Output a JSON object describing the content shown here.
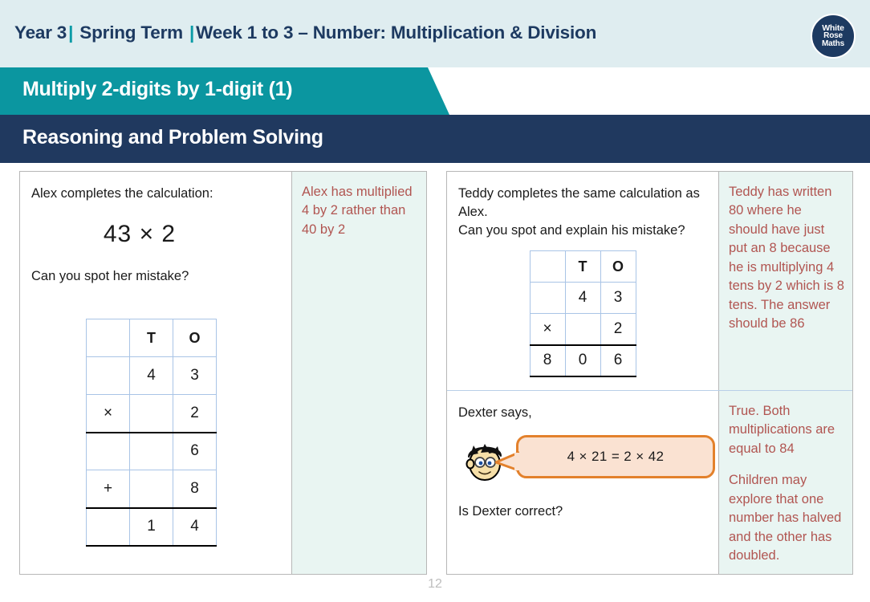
{
  "header": {
    "year": "Year 3",
    "term": "Spring Term",
    "week": "Week 1 to 3 – Number: Multiplication & Division",
    "separator": "|",
    "logo": {
      "line1": "White",
      "line2": "Rose",
      "line3": "Maths"
    },
    "colors": {
      "band": "#dfedf0",
      "text": "#1d3a61",
      "accent": "#0b9ba6"
    }
  },
  "title_bar": {
    "lesson_title": "Multiply 2-digits by 1-digit (1)",
    "section_title": "Reasoning and Problem Solving",
    "colors": {
      "teal": "#0b96a0",
      "navy": "#20395f"
    }
  },
  "questions": [
    {
      "id": "alex",
      "prompt": "Alex completes the calculation:",
      "equation": "43 × 2",
      "follow_up": "Can you spot her mistake?",
      "table": {
        "rows": [
          {
            "cells": [
              "",
              "T",
              "O"
            ],
            "header": true,
            "rule_below": false
          },
          {
            "cells": [
              "",
              "4",
              "3"
            ],
            "header": false,
            "rule_below": false
          },
          {
            "cells": [
              "×",
              "",
              "2"
            ],
            "header": false,
            "rule_below": true
          },
          {
            "cells": [
              "",
              "",
              "6"
            ],
            "header": false,
            "rule_below": false
          },
          {
            "cells": [
              "+",
              "",
              "8"
            ],
            "header": false,
            "rule_below": true
          },
          {
            "cells": [
              "",
              "1",
              "4"
            ],
            "header": false,
            "rule_below": true
          }
        ]
      },
      "answer": "Alex has multiplied 4 by 2 rather than 40 by 2"
    },
    {
      "id": "teddy",
      "prompt_line1": "Teddy completes the same calculation as Alex.",
      "prompt_line2": "Can you spot and explain his mistake?",
      "table": {
        "rows": [
          {
            "cells": [
              "",
              "T",
              "O"
            ],
            "header": true,
            "rule_below": false
          },
          {
            "cells": [
              "",
              "4",
              "3"
            ],
            "header": false,
            "rule_below": false
          },
          {
            "cells": [
              "×",
              "",
              "2"
            ],
            "header": false,
            "rule_below": true
          },
          {
            "cells": [
              "8",
              "0",
              "6"
            ],
            "header": false,
            "rule_below": true
          }
        ]
      },
      "answer": "Teddy has written 80 where he should have just put an 8 because he is multiplying 4 tens by 2 which is 8 tens. The answer should be 86"
    },
    {
      "id": "dexter",
      "prompt": "Dexter says,",
      "speech": "4 × 21 = 2 × 42",
      "follow_up": "Is Dexter correct?",
      "answer_part1": "True. Both multiplications are equal to 84",
      "answer_part2": "Children may explore that one number has halved and the other has doubled.",
      "colors": {
        "bubble_fill": "#fae2d2",
        "bubble_border": "#e3812c"
      }
    }
  ],
  "footer": {
    "page_number": "12"
  }
}
